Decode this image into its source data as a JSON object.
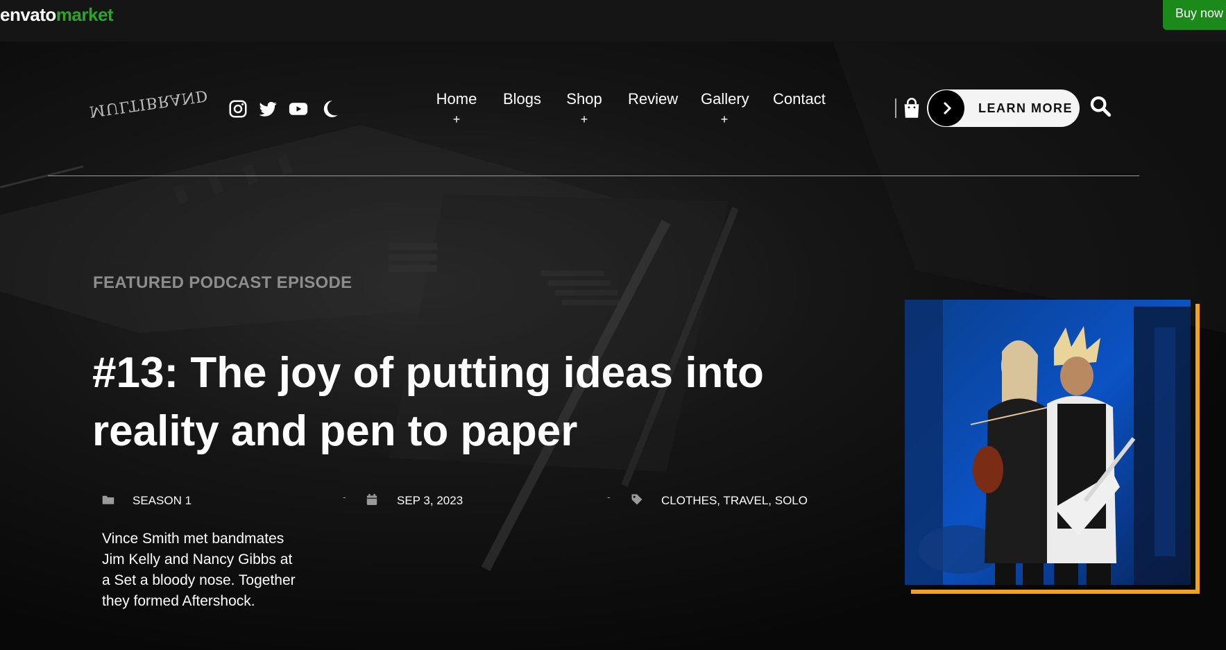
{
  "envato_bar": {
    "logo_part1": "envato",
    "logo_part2": "market",
    "buy_now": "Buy now",
    "colors": {
      "bar": "#151515",
      "market": "#2aa52a",
      "buy_bg": "#1b8a1b"
    }
  },
  "header": {
    "brand": "MULTIBRAND",
    "social_icons": [
      "instagram-icon",
      "twitter-icon",
      "youtube-icon",
      "moon-icon"
    ],
    "nav": [
      {
        "label": "Home",
        "submenu": "+"
      },
      {
        "label": "Blogs"
      },
      {
        "label": "Shop",
        "submenu": "+"
      },
      {
        "label": "Review"
      },
      {
        "label": "Gallery",
        "submenu": "+"
      },
      {
        "label": "Contact"
      }
    ],
    "cta": {
      "label": "LEARN MORE",
      "icon": "chevron-right-icon"
    },
    "icons": [
      "shopping-bag-icon",
      "search-icon"
    ]
  },
  "featured": {
    "eyebrow": "FEATURED PODCAST EPISODE",
    "title": "#13: The joy of putting ideas into reality and pen to paper",
    "meta": {
      "category": "SEASON 1",
      "date": "SEP 3, 2023",
      "tags": "CLOTHES, TRAVEL, SOLO",
      "separator": "-"
    },
    "excerpt": "Vince Smith met bandmates Jim Kelly and Nancy Gibbs at a Set a bloody nose. Together they formed Aftershock.",
    "accent_color": "#f2a21d"
  }
}
